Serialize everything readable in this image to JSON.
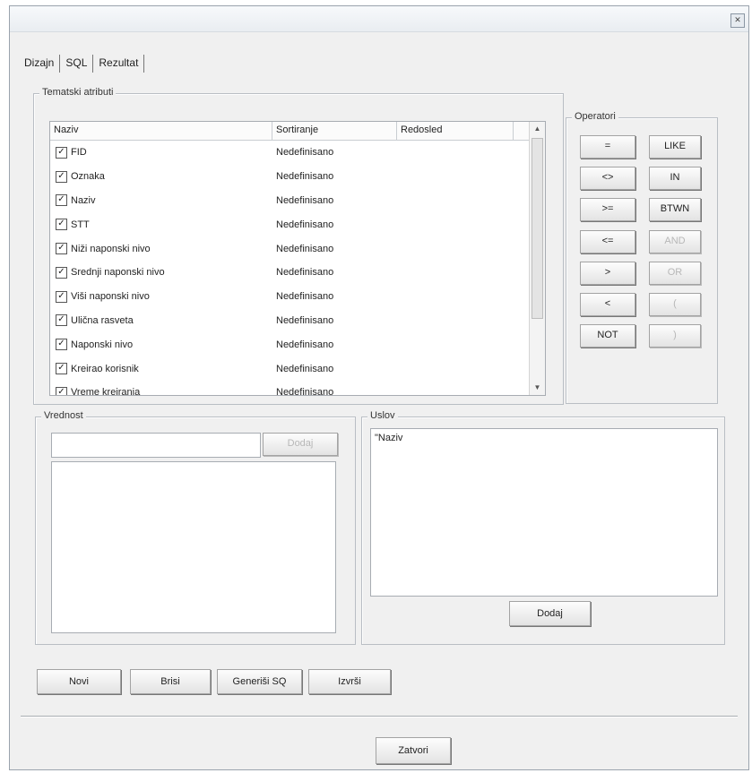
{
  "tabs": [
    "Dizajn",
    "SQL",
    "Rezultat"
  ],
  "attributes_group": {
    "title": "Tematski atributi",
    "columns": [
      "Naziv",
      "Sortiranje",
      "Redosled"
    ],
    "rows": [
      {
        "name": "FID",
        "sort": "Nedefinisano"
      },
      {
        "name": "Oznaka",
        "sort": "Nedefinisano"
      },
      {
        "name": "Naziv",
        "sort": "Nedefinisano"
      },
      {
        "name": "STT",
        "sort": "Nedefinisano"
      },
      {
        "name": "Niži naponski nivo",
        "sort": "Nedefinisano"
      },
      {
        "name": "Srednji naponski nivo",
        "sort": "Nedefinisano"
      },
      {
        "name": "Viši naponski nivo",
        "sort": "Nedefinisano"
      },
      {
        "name": "Ulična rasveta",
        "sort": "Nedefinisano"
      },
      {
        "name": "Naponski nivo",
        "sort": "Nedefinisano"
      },
      {
        "name": "Kreirao korisnik",
        "sort": "Nedefinisano"
      },
      {
        "name": "Vreme kreiranja",
        "sort": "Nedefinisano"
      }
    ]
  },
  "operators": {
    "title": "Operatori",
    "left": [
      "=",
      "<>",
      ">=",
      "<=",
      ">",
      "<",
      "NOT"
    ],
    "right": [
      "LIKE",
      "IN",
      "BTWN",
      "AND",
      "OR",
      "(",
      ")"
    ]
  },
  "value_group": {
    "title": "Vrednost",
    "button": "Dodaj"
  },
  "condition_group": {
    "title": "Uslov",
    "text": "\"Naziv",
    "button": "Dodaj"
  },
  "actions": {
    "new": "Novi",
    "delete": "Brisi",
    "generate": "Generiši SQ",
    "run": "Izvrši"
  },
  "close_label": "Zatvori",
  "close_icon": "x-icon"
}
